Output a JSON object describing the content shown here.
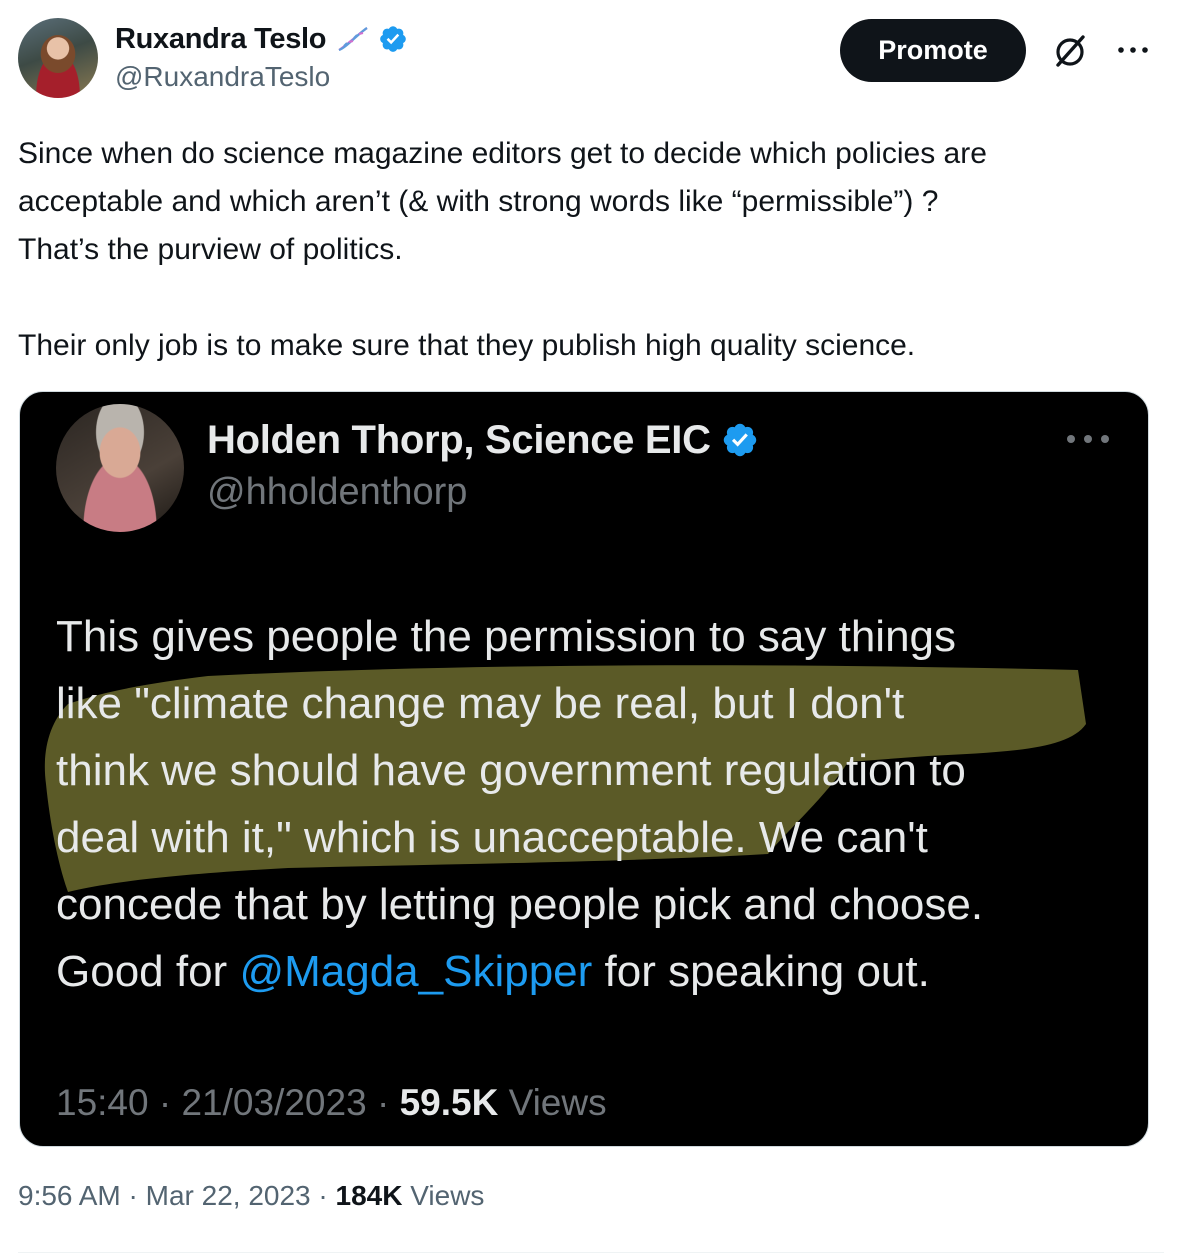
{
  "author": {
    "display_name": "Ruxandra Teslo",
    "handle": "@RuxandraTeslo",
    "badge_emoji_icon": "dna-icon",
    "verified_icon": "verified-badge-icon"
  },
  "header": {
    "promote_label": "Promote",
    "grok_icon": "grok-icon",
    "more_icon": "more-options-icon"
  },
  "tweet": {
    "line1": "Since when do science magazine editors get to decide which policies are",
    "line2": "acceptable and which aren’t (& with strong words like “permissible”) ?",
    "line3": "That’s the purview of politics.",
    "line4": "Their only job is to make sure that they publish high quality science."
  },
  "embedded": {
    "display_name": "Holden Thorp, Science EIC",
    "handle": "@hholdenthorp",
    "lines": [
      "This gives people the permission to say things",
      "like \"climate change may be real, but I don't",
      "think we should have government regulation to",
      "deal with it,\" which is unacceptable.  We can't",
      "concede that by letting people pick and choose."
    ],
    "last_line_prefix": "Good for ",
    "mention": "@Magda_Skipper",
    "last_line_suffix": " for speaking out.",
    "time": "15:40",
    "date": "21/03/2023",
    "views_count": "59.5K",
    "views_label": "Views",
    "highlight_color": "#6b6a2e"
  },
  "meta": {
    "time": "9:56 AM",
    "date": "Mar 22, 2023",
    "views_count": "184K",
    "views_label": "Views"
  },
  "colors": {
    "accent": "#1d9bf0",
    "text_primary": "#0f1419",
    "text_secondary": "#536471"
  }
}
